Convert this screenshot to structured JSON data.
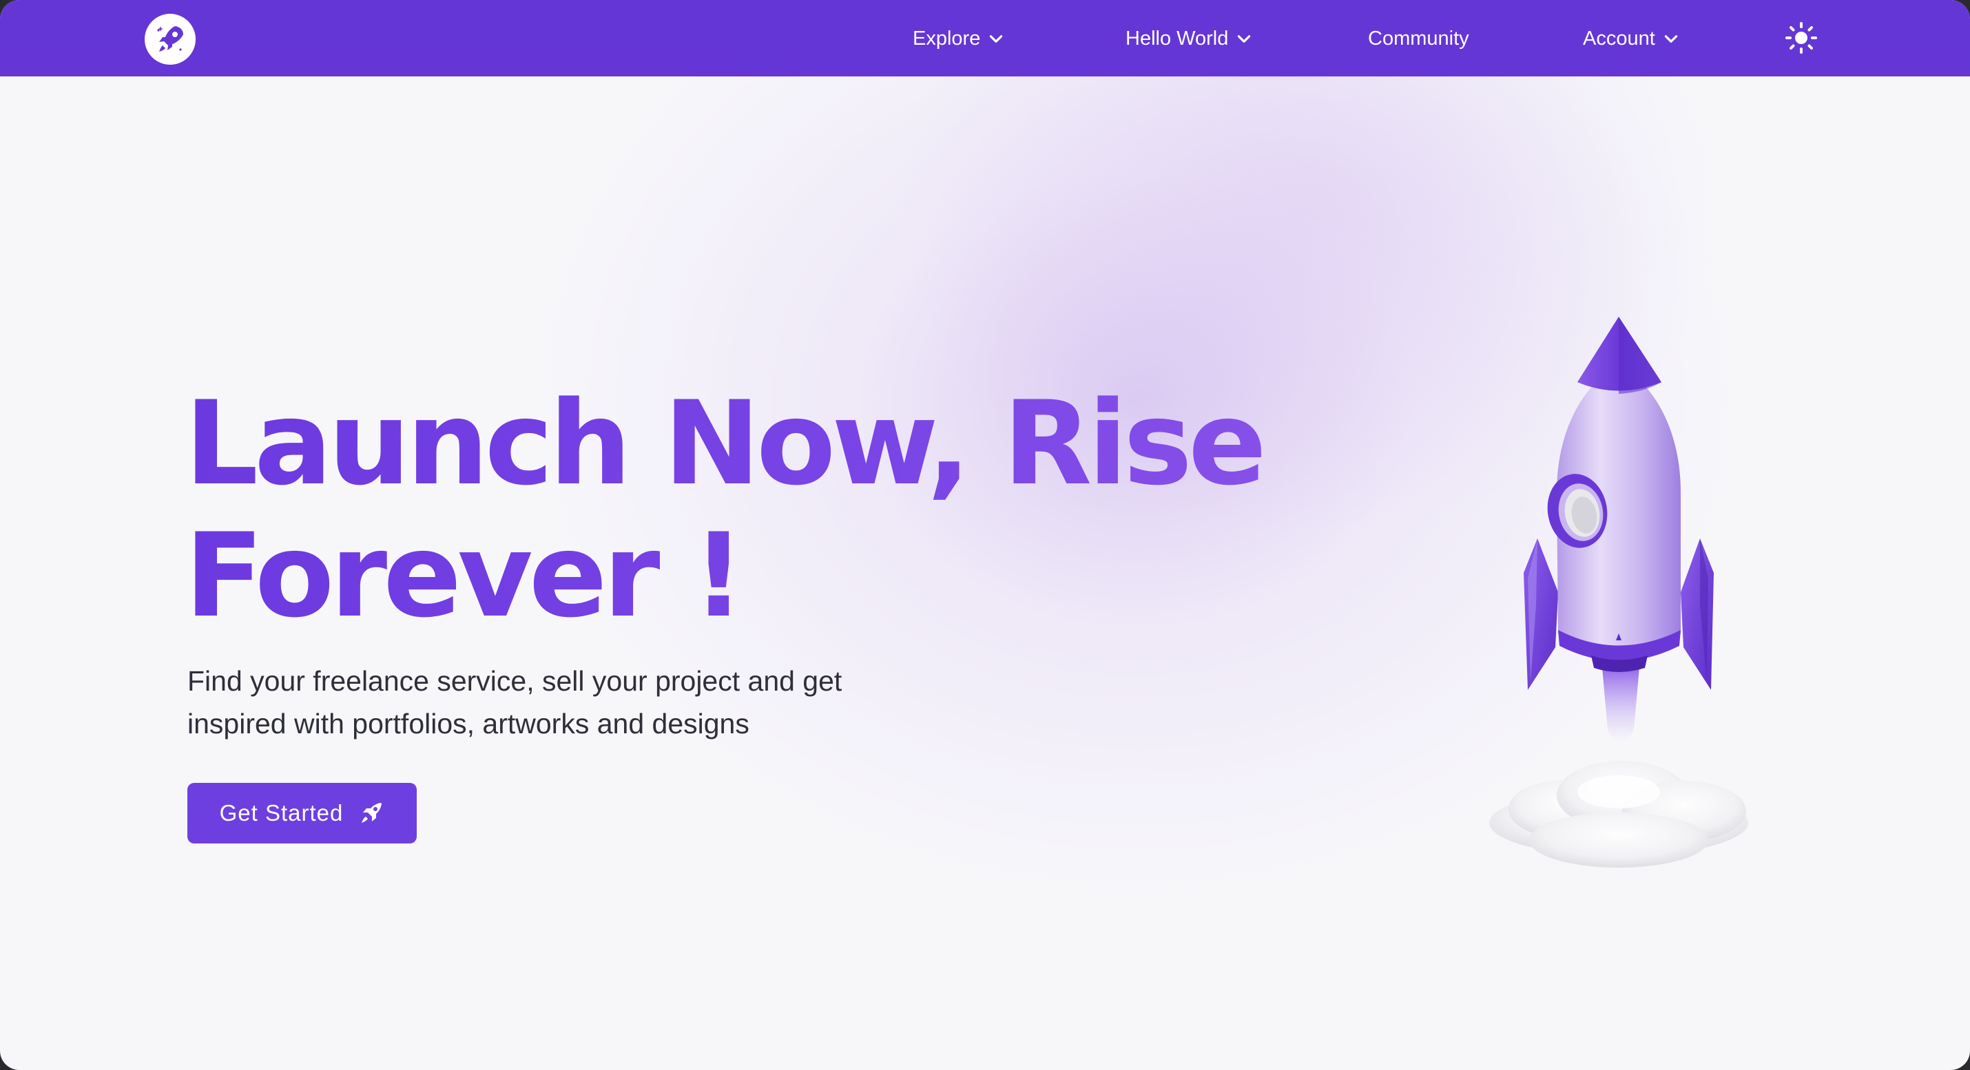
{
  "nav": {
    "logo": "rocket-logo-icon",
    "items": [
      {
        "label": "Explore",
        "has_dropdown": true
      },
      {
        "label": "Hello World",
        "has_dropdown": true
      },
      {
        "label": "Community",
        "has_dropdown": false
      },
      {
        "label": "Account",
        "has_dropdown": true
      }
    ],
    "theme_toggle_icon": "sun-icon"
  },
  "hero": {
    "headline_line1": "Launch Now, Rise",
    "headline_line2": "Forever !",
    "subtitle_line1": "Find your freelance service, sell your project and get",
    "subtitle_line2": "inspired with portfolios, artworks and designs",
    "cta_label": "Get Started",
    "cta_icon": "rocket-icon",
    "illustration": "rocket-launch-illustration"
  },
  "colors": {
    "brand": "#6536d6",
    "headline": "#6f3ee3",
    "button": "#6e3fe0",
    "background": "#f7f7fa",
    "text": "#2f2f3a"
  }
}
